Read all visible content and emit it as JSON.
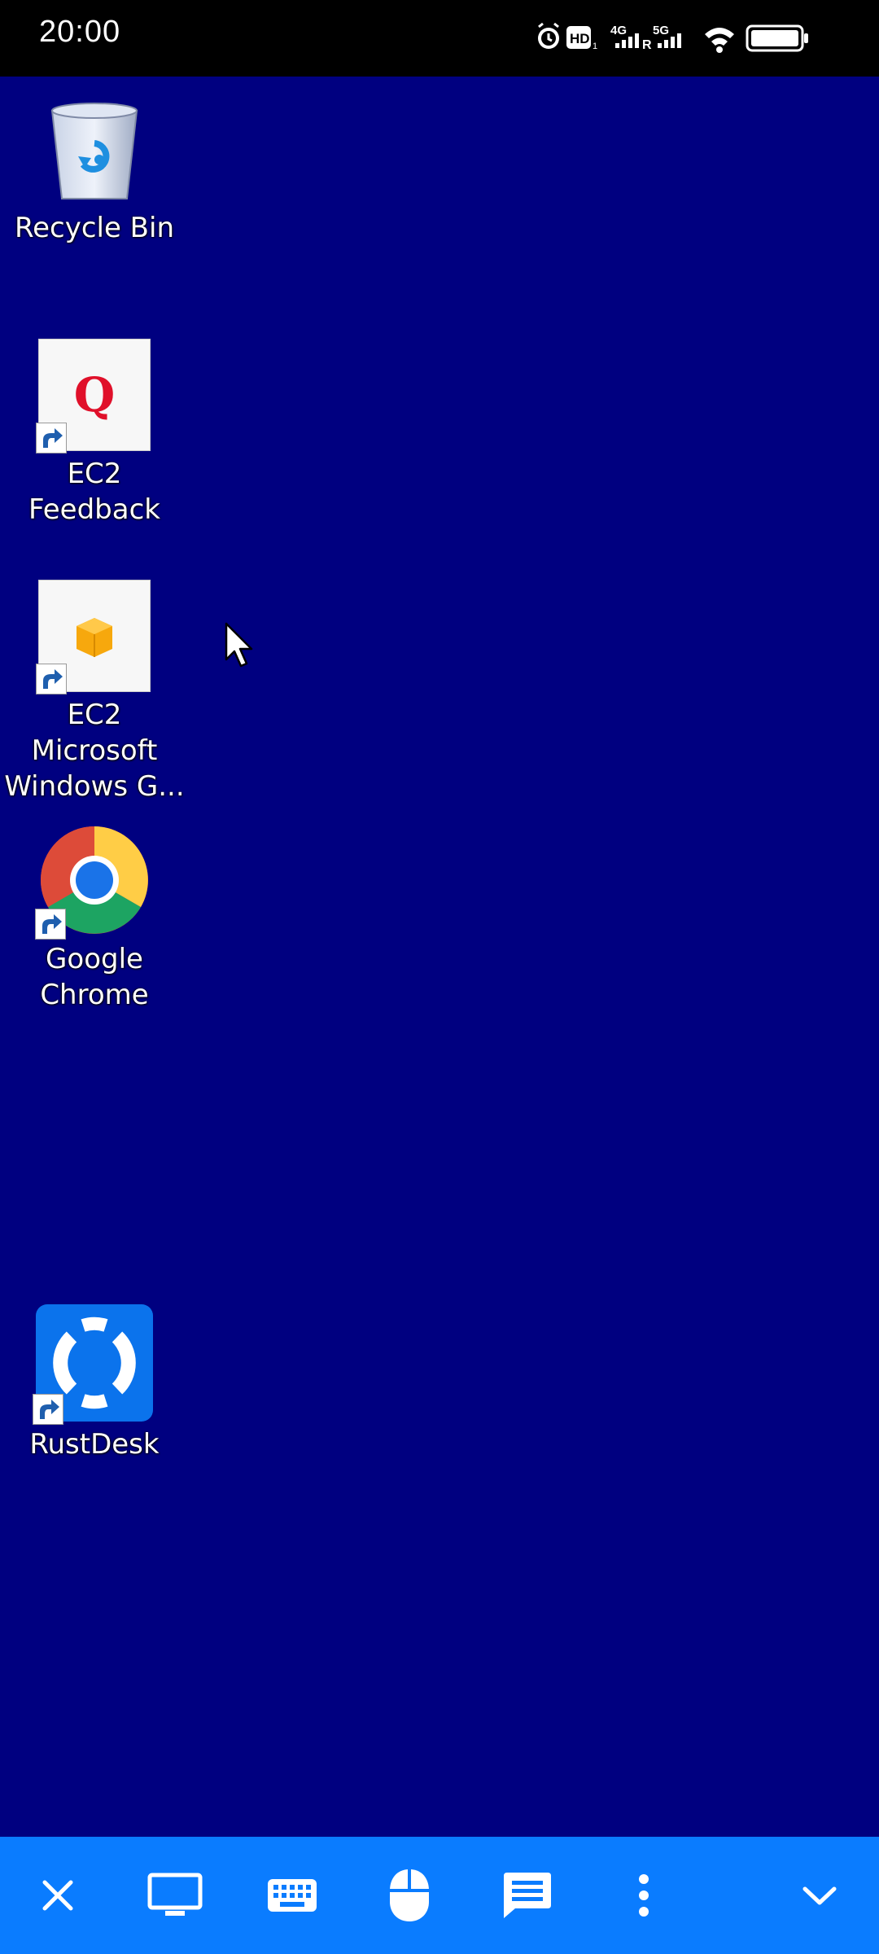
{
  "status_bar": {
    "time": "20:00",
    "icons": [
      "alarm-icon",
      "hd-icon",
      "4g-signal-icon",
      "roaming-icon",
      "5g-signal-icon",
      "wifi-icon",
      "battery-icon"
    ],
    "network_labels": {
      "hd": "HD",
      "hd_sub": "1",
      "net1": "4G",
      "roaming": "R",
      "net2": "5G"
    }
  },
  "desktop": {
    "background_color": "#000080",
    "icons": [
      {
        "label": "Recycle Bin",
        "icon": "recycle-bin-icon",
        "shortcut": false
      },
      {
        "label": "EC2 Feedback",
        "icon": "ec2-feedback-icon",
        "glyph": "Q",
        "shortcut": true
      },
      {
        "label": "EC2 Microsoft\nWindows G...",
        "icon": "ec2-windows-guide-icon",
        "shortcut": true
      },
      {
        "label": "Google\nChrome",
        "icon": "chrome-icon",
        "shortcut": true
      },
      {
        "label": "RustDesk",
        "icon": "rustdesk-icon",
        "shortcut": true
      }
    ]
  },
  "toolbar": {
    "background_color": "#0a7cff",
    "buttons": [
      "close-icon",
      "display-icon",
      "keyboard-icon",
      "mouse-icon",
      "chat-icon",
      "more-icon",
      "collapse-icon"
    ]
  }
}
